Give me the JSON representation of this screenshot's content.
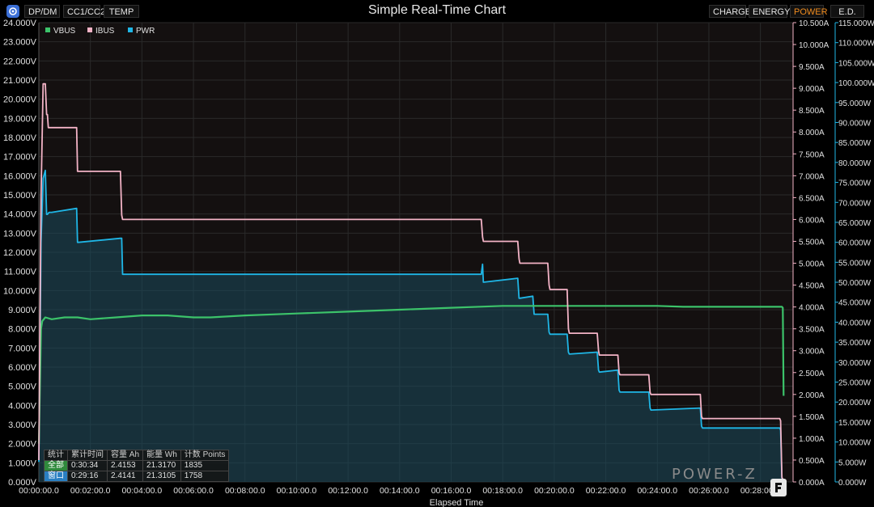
{
  "header": {
    "tabs_left": [
      "DP/DM",
      "CC1/CC2",
      "TEMP"
    ],
    "title": "Simple Real-Time Chart",
    "tabs_right": [
      "CHARGE",
      "ENERGY",
      "POWER",
      "E.D."
    ],
    "active_tab": "POWER"
  },
  "stats": {
    "headers": [
      "统计",
      "累计时间",
      "容量 Ah",
      "能量 Wh",
      "计数 Points"
    ],
    "rows": [
      [
        "全部",
        "0:30:34",
        "2.4153",
        "21.3170",
        "1835"
      ],
      [
        "窗口",
        "0:29:16",
        "2.4141",
        "21.3105",
        "1758"
      ]
    ]
  },
  "logo": {
    "text": "POWER-Z"
  },
  "colors": {
    "vbus": "#3cc36a",
    "ibus": "#f3b3c6",
    "pwr": "#1fb6e6",
    "grid": "#2a2a2a",
    "axis_text": "#e0e0e0"
  },
  "chart_data": {
    "type": "line",
    "title": "Simple Real-Time Chart",
    "xlabel": "Elapsed Time",
    "x_ticks": [
      "00:00:00.0",
      "00:02:00.0",
      "00:04:00.0",
      "00:06:00.0",
      "00:08:00.0",
      "00:10:00.0",
      "00:12:00.0",
      "00:14:00.0",
      "00:16:00.0",
      "00:18:00.0",
      "00:20:00.0",
      "00:22:00.0",
      "00:24:00.0",
      "00:26:00.0",
      "00:28:00.0"
    ],
    "xlim_seconds": [
      0,
      1756
    ],
    "y_left": {
      "unit": "V",
      "ylim": [
        0,
        24
      ],
      "step": 1,
      "decimals": 3
    },
    "y_right1": {
      "unit": "A",
      "ylim": [
        0,
        10.5
      ],
      "step": 0.5,
      "decimals": 3
    },
    "y_right2": {
      "unit": "W",
      "ylim": [
        0,
        115
      ],
      "step": 5,
      "decimals": 3
    },
    "grid": true,
    "legend": "top-left",
    "series": [
      {
        "name": "VBUS",
        "axis": "left",
        "x": [
          0,
          5,
          8,
          15,
          30,
          60,
          90,
          120,
          180,
          240,
          300,
          360,
          400,
          480,
          600,
          720,
          840,
          960,
          1080,
          1140,
          1200,
          1260,
          1320,
          1380,
          1440,
          1500,
          1560,
          1620,
          1680,
          1730,
          1732,
          1734
        ],
        "y": [
          2.0,
          8.0,
          8.4,
          8.6,
          8.5,
          8.6,
          8.6,
          8.5,
          8.6,
          8.7,
          8.7,
          8.6,
          8.6,
          8.7,
          8.8,
          8.9,
          9.0,
          9.1,
          9.2,
          9.2,
          9.2,
          9.2,
          9.2,
          9.2,
          9.2,
          9.15,
          9.15,
          9.15,
          9.15,
          9.15,
          9.1,
          4.5
        ]
      },
      {
        "name": "IBUS",
        "axis": "right1",
        "x": [
          0,
          5,
          10,
          15,
          18,
          20,
          22,
          24,
          30,
          88,
          90,
          92,
          190,
          193,
          195,
          1030,
          1033,
          1035,
          1115,
          1118,
          1120,
          1185,
          1188,
          1190,
          1230,
          1233,
          1235,
          1300,
          1303,
          1305,
          1348,
          1351,
          1353,
          1420,
          1423,
          1425,
          1540,
          1543,
          1545,
          1725,
          1727,
          1730,
          1733
        ],
        "y": [
          0.5,
          6.5,
          9.1,
          9.1,
          8.4,
          8.4,
          8.1,
          8.1,
          8.1,
          8.1,
          7.1,
          7.1,
          7.1,
          6.1,
          6.0,
          6.0,
          5.6,
          5.5,
          5.5,
          5.1,
          5.0,
          5.0,
          4.5,
          4.4,
          4.4,
          3.5,
          3.4,
          3.4,
          3.0,
          2.9,
          2.9,
          2.5,
          2.45,
          2.45,
          2.05,
          2.0,
          2.0,
          1.5,
          1.45,
          1.45,
          1.4,
          0.1,
          0.05
        ]
      },
      {
        "name": "PWR",
        "axis": "right2",
        "x": [
          0,
          5,
          10,
          15,
          18,
          20,
          24,
          30,
          88,
          90,
          92,
          190,
          193,
          195,
          1030,
          1033,
          1035,
          1115,
          1118,
          1120,
          1150,
          1153,
          1155,
          1185,
          1188,
          1190,
          1230,
          1233,
          1235,
          1300,
          1303,
          1305,
          1348,
          1351,
          1353,
          1420,
          1423,
          1425,
          1540,
          1543,
          1545,
          1725,
          1727,
          1730,
          1733
        ],
        "y": [
          5,
          60,
          76,
          78,
          67,
          67,
          67.5,
          67.5,
          68.5,
          60,
          60,
          61,
          61,
          52,
          52,
          54.5,
          50,
          51,
          46,
          46,
          46.5,
          42,
          42,
          42,
          37.5,
          37,
          37,
          32.5,
          32,
          32.5,
          28,
          27.5,
          28,
          23,
          22.5,
          22.5,
          18.5,
          18,
          18.5,
          14,
          13.5,
          13.5,
          13,
          1.0,
          0.5
        ]
      }
    ]
  }
}
